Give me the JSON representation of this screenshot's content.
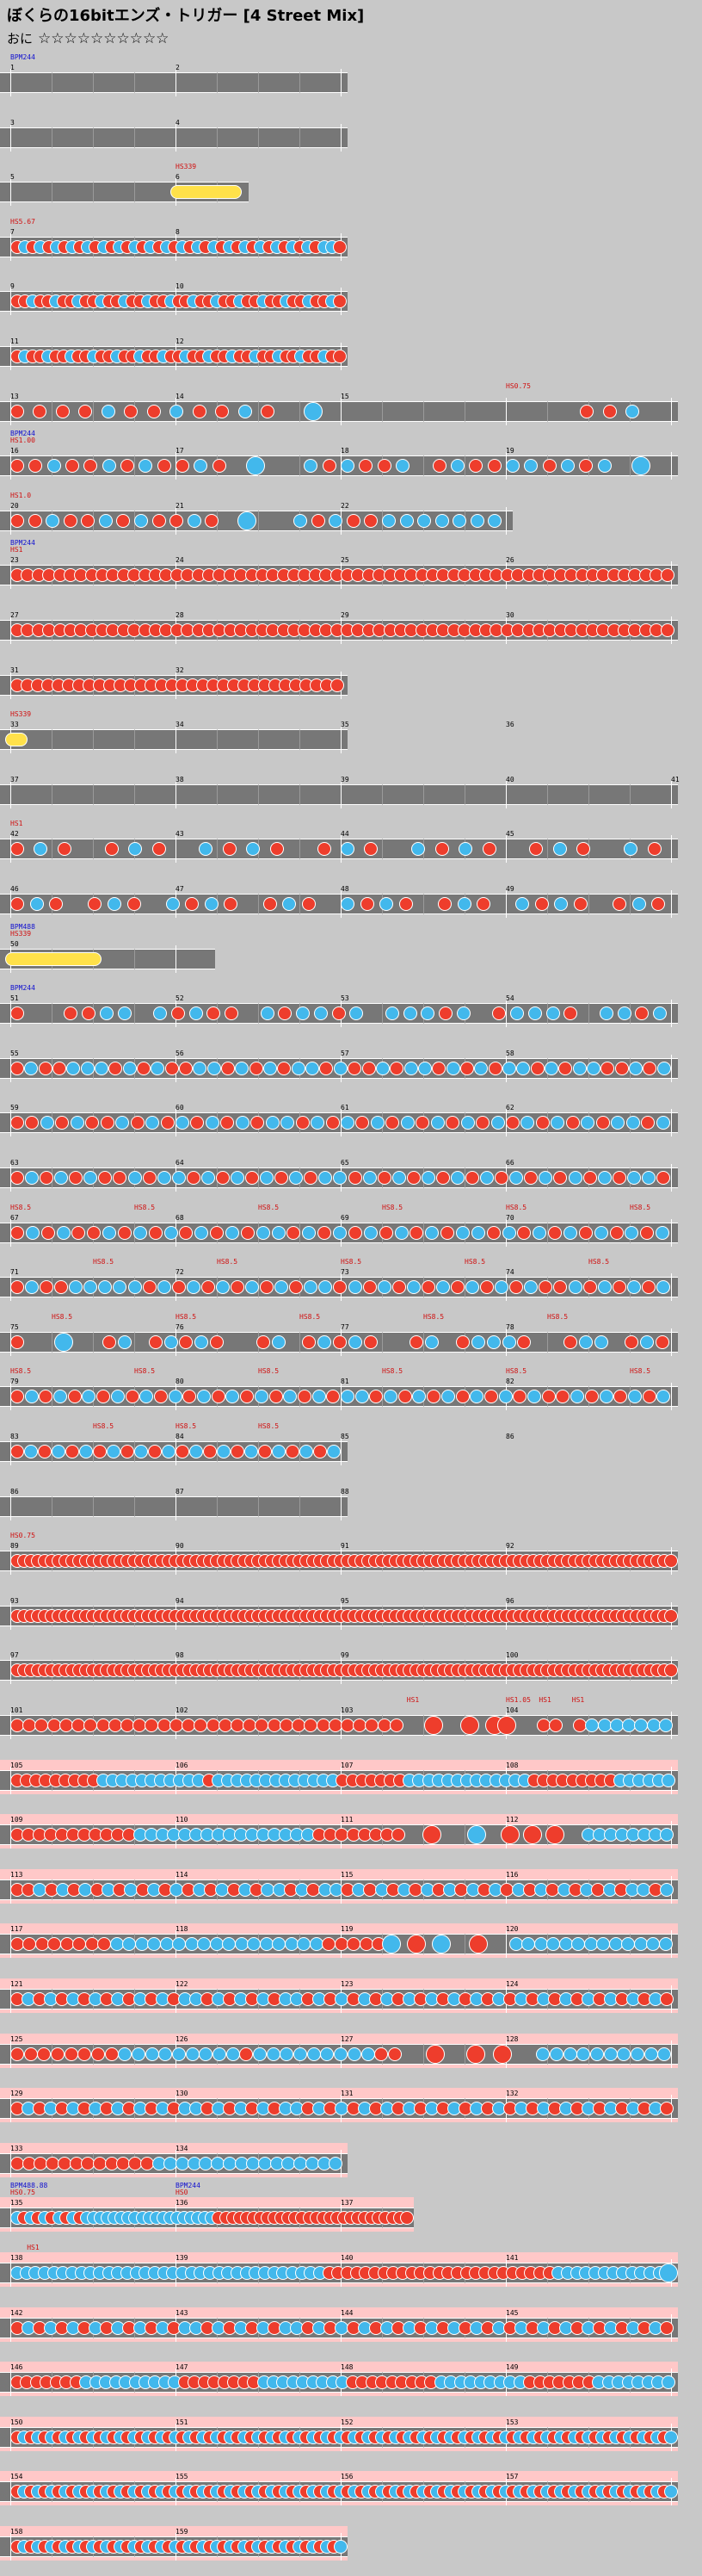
{
  "header": {
    "title": "ぼくらの16bitエンズ・トリガー [4 Street Mix]",
    "difficulty_label": "おに",
    "stars": "☆☆☆☆☆☆☆☆☆☆"
  },
  "colors": {
    "background": "#c8c8c8",
    "lane": "#777777",
    "don": "#ee3d2c",
    "ka": "#42b8ec",
    "roll": "#ffe14a",
    "gogo": "#ffc8c8",
    "bpm_text": "#1010d0",
    "hs_text": "#d01010"
  },
  "rows": [
    {
      "numbers": [
        "1",
        "2"
      ],
      "measures": 2,
      "events": [
        {
          "text": "BPM244",
          "type": "bpm",
          "measure": 0
        }
      ],
      "pattern": ""
    },
    {
      "numbers": [
        "3",
        "4"
      ],
      "measures": 2,
      "events": [],
      "pattern": ""
    },
    {
      "numbers": [
        "5",
        "6"
      ],
      "measures": 1.4,
      "events": [
        {
          "text": "HS339",
          "type": "hs",
          "measure": 1
        }
      ],
      "pattern": "roll:1.0-1.35"
    },
    {
      "numbers": [
        "7",
        "8"
      ],
      "measures": 2,
      "events": [
        {
          "text": "HS5.67",
          "type": "hs",
          "measure": 0
        }
      ],
      "pattern": "dkdkdkdkdkdkdkdkdkdkdkdkdkdkdkdkdkdkdkdkkd"
    },
    {
      "numbers": [
        "9",
        "10"
      ],
      "measures": 2,
      "events": [],
      "pattern": "ddkddkddkddkddkddkddkddkddkddkddkddkddkddkd"
    },
    {
      "numbers": [
        "11",
        "12"
      ],
      "measures": 2,
      "events": [],
      "pattern": "dkddkddkddkddkddkddkddkddkddkddkddkddkddkdd"
    },
    {
      "numbers": [
        "13",
        "14",
        "15"
      ],
      "measures": 4,
      "events": [
        {
          "text": "HS0.75",
          "type": "hs",
          "measure": 3
        }
      ],
      "pattern": "ddddkddkddkd.K...........ddk."
    },
    {
      "numbers": [
        "16",
        "17",
        "18",
        "19"
      ],
      "measures": 4,
      "events": [
        {
          "text": "HS1.00",
          "type": "hs",
          "measure": 0
        },
        {
          "text": "BPM244",
          "type": "bpm",
          "measure": 0
        }
      ],
      "pattern": "ddkddkdkddkd.K..kdkddk.dkddkkdkdk.K."
    },
    {
      "numbers": [
        "20",
        "21",
        "22"
      ],
      "measures": 3,
      "events": [
        {
          "text": "HS1.0",
          "type": "hs",
          "measure": 0
        }
      ],
      "pattern": "ddkddkdkddkd.K..kdkddkkkkkkk"
    },
    {
      "numbers": [
        "23",
        "24",
        "25",
        "26"
      ],
      "measures": 4,
      "events": [
        {
          "text": "HS1",
          "type": "hs",
          "measure": 0
        },
        {
          "text": "BPM244",
          "type": "bpm",
          "measure": 0
        }
      ],
      "pattern": "dddddddddddddddddddddddddddddddddddddddddddddddddddddddddddddd"
    },
    {
      "numbers": [
        "27",
        "28",
        "29",
        "30"
      ],
      "measures": 4,
      "events": [],
      "pattern": "dddddddddddddddddddddddddddddddddddddddddddddddddddddddddddddd"
    },
    {
      "numbers": [
        "31",
        "32"
      ],
      "measures": 2,
      "events": [],
      "pattern": "dddddddddddddddddddddddddddddddd"
    },
    {
      "numbers": [
        "33",
        "34",
        "35",
        "36"
      ],
      "measures": 2,
      "events": [
        {
          "text": "HS339",
          "type": "hs",
          "measure": 0
        }
      ],
      "pattern": "roll:0.0-0.05"
    },
    {
      "numbers": [
        "37",
        "38",
        "39",
        "40",
        "41"
      ],
      "measures": 4,
      "events": [],
      "pattern": ""
    },
    {
      "numbers": [
        "42",
        "43",
        "44",
        "45"
      ],
      "measures": 4,
      "events": [
        {
          "text": "HS1",
          "type": "hs",
          "measure": 0
        }
      ],
      "pattern": "dkd.dkd.kdkd.dkd.kdkd.dkd.kd"
    },
    {
      "numbers": [
        "46",
        "47",
        "48",
        "49"
      ],
      "measures": 4,
      "events": [],
      "pattern": "dkd.dkd.kdkd.dkd.kdkd.dkd.kdkd.dkd"
    },
    {
      "numbers": [
        "50"
      ],
      "measures": 1.2,
      "events": [
        {
          "text": "HS339",
          "type": "hs",
          "measure": 0
        },
        {
          "text": "BPM488",
          "type": "bpm",
          "measure": 0
        }
      ],
      "pattern": "roll:0.0-0.5"
    },
    {
      "numbers": [
        "51",
        "52",
        "53",
        "54"
      ],
      "measures": 4,
      "events": [
        {
          "text": "BPM244",
          "type": "bpm",
          "measure": 0
        }
      ],
      "pattern": "d..ddkk.kdkdd.kdkkdk.kkkdk.dkkkd.kkdk"
    },
    {
      "numbers": [
        "55",
        "56",
        "57",
        "58"
      ],
      "measures": 4,
      "events": [],
      "pattern": "dkddkkkdkdkddkkdkdkdkkdkddkdkkdkdkdkkdkdkkddkdk"
    },
    {
      "numbers": [
        "59",
        "60",
        "61",
        "62"
      ],
      "measures": 4,
      "events": [],
      "pattern": "ddkdkddkdkdkdkdkdkkdkdkdkdkdkdkdkdkdkdkdkkdk"
    },
    {
      "numbers": [
        "63",
        "64",
        "65",
        "66"
      ],
      "measures": 4,
      "events": [],
      "pattern": "dkdkdkddkdkkdkdkdkdkdkkdkdkdkdkdkdkdkdkdkdkkd"
    },
    {
      "numbers": [
        "67",
        "68",
        "69",
        "70"
      ],
      "measures": 4,
      "events": [
        {
          "text": "HS8.5",
          "type": "hs",
          "measure": 0
        },
        {
          "text": "HS8.5",
          "type": "hs",
          "measure": 0.75
        },
        {
          "text": "HS8.5",
          "type": "hs",
          "measure": 1.5
        },
        {
          "text": "HS8.5",
          "type": "hs",
          "measure": 2.25
        },
        {
          "text": "HS8.5",
          "type": "hs",
          "measure": 3.0
        },
        {
          "text": "HS8.5",
          "type": "hs",
          "measure": 3.75
        }
      ],
      "pattern": "dkdkddkdkdkdkdkdkkdkdkdkdkdkdkkdkdkdkdkdkdk"
    },
    {
      "numbers": [
        "71",
        "72",
        "73",
        "74"
      ],
      "measures": 4,
      "events": [
        {
          "text": "HS8.5",
          "type": "hs",
          "measure": 0.5
        },
        {
          "text": "HS8.5",
          "type": "hs",
          "measure": 1.25
        },
        {
          "text": "HS8.5",
          "type": "hs",
          "measure": 2.0
        },
        {
          "text": "HS8.5",
          "type": "hs",
          "measure": 2.75
        },
        {
          "text": "HS8.5",
          "type": "hs",
          "measure": 3.5
        }
      ],
      "pattern": "dkddkkkkkdkdkdkdkdkdkkdkdkdkdkdkdkdkddkdkdkdk"
    },
    {
      "numbers": [
        "75",
        "76",
        "77",
        "78"
      ],
      "measures": 4,
      "events": [
        {
          "text": "HS8.5",
          "type": "hs",
          "measure": 0.25
        },
        {
          "text": "HS8.5",
          "type": "hs",
          "measure": 1.0
        },
        {
          "text": "HS8.5",
          "type": "hs",
          "measure": 1.75
        },
        {
          "text": "HS8.5",
          "type": "hs",
          "measure": 2.5
        },
        {
          "text": "HS8.5",
          "type": "hs",
          "measure": 3.25
        }
      ],
      "pattern": "d..K..dk.dkdkd..dk.dkdkd..dk.dkkkd..dkk.dkd"
    },
    {
      "numbers": [
        "79",
        "80",
        "81",
        "82"
      ],
      "measures": 4,
      "events": [
        {
          "text": "HS8.5",
          "type": "hs",
          "measure": 0
        },
        {
          "text": "HS8.5",
          "type": "hs",
          "measure": 0.75
        },
        {
          "text": "HS8.5",
          "type": "hs",
          "measure": 1.5
        },
        {
          "text": "HS8.5",
          "type": "hs",
          "measure": 2.25
        },
        {
          "text": "HS8.5",
          "type": "hs",
          "measure": 3.0
        },
        {
          "text": "HS8.5",
          "type": "hs",
          "measure": 3.75
        }
      ],
      "pattern": "dkdkdkdkdkdkdkdkdkdkdkdkkdkdkdkdkdkdkddkdkdkdk"
    },
    {
      "numbers": [
        "83",
        "84",
        "85",
        "86"
      ],
      "measures": 2,
      "events": [
        {
          "text": "HS8.5",
          "type": "hs",
          "measure": 0.5
        },
        {
          "text": "HS8.5",
          "type": "hs",
          "measure": 1.0
        },
        {
          "text": "HS8.5",
          "type": "hs",
          "measure": 1.5
        }
      ],
      "pattern": "dkdkdkdkdkdkdkdkdkdkdkdk"
    },
    {
      "numbers": [
        "86",
        "87",
        "88"
      ],
      "measures": 2,
      "events": [],
      "pattern": ""
    },
    {
      "numbers": [
        "89",
        "90",
        "91",
        "92"
      ],
      "measures": 4,
      "events": [
        {
          "text": "HS0.75",
          "type": "hs",
          "measure": 0
        }
      ],
      "pattern": "X96"
    },
    {
      "numbers": [
        "93",
        "94",
        "95",
        "96"
      ],
      "measures": 4,
      "events": [],
      "pattern": "X96"
    },
    {
      "numbers": [
        "97",
        "98",
        "99",
        "100"
      ],
      "measures": 4,
      "events": [],
      "pattern": "X96"
    },
    {
      "numbers": [
        "101",
        "102",
        "103",
        "104"
      ],
      "measures": 4,
      "events": [
        {
          "text": "HS1",
          "type": "hs",
          "measure": 2.4
        },
        {
          "text": "HS1.05",
          "type": "hs",
          "measure": 3.0
        },
        {
          "text": "HS1",
          "type": "hs",
          "measure": 3.2
        },
        {
          "text": "HS1",
          "type": "hs",
          "measure": 3.4
        }
      ],
      "pattern": "dddddddddddddddddddddddddddddddd..D..D.DD..dd.dkkkkkkk"
    },
    {
      "numbers": [
        "105",
        "106",
        "107",
        "108"
      ],
      "measures": 4,
      "events": [],
      "pattern": "gogo:dddddddddkkkkkkkkkkkdkkkkkkkkkkkkkdddddddkkkkkkkkkkkkkdddddddddkkkkkk"
    },
    {
      "numbers": [
        "109",
        "110",
        "111",
        "112"
      ],
      "measures": 4,
      "events": [],
      "pattern": "gogo:dddddddddddkkkkkkkkkkkkkkkkdddddddd..D...K..D.D.D..kkkkkkkk"
    },
    {
      "numbers": [
        "113",
        "114",
        "115",
        "116"
      ],
      "measures": 4,
      "events": [],
      "pattern": "gogo:ddkdkdkdkdkdkdkdkdkdkdkkdkdkkdkdkdkdkdkdkdkdkdkdkdkdkdkkdk"
    },
    {
      "numbers": [
        "117",
        "118",
        "119",
        "120"
      ],
      "measures": 4,
      "events": [],
      "pattern": "gogo:ddddddddkkkkkkkkkkkkkkkkkdddddK.D.K..D..kkkkkkkkkkkkk"
    },
    {
      "numbers": [
        "121",
        "122",
        "123",
        "124"
      ],
      "measures": 4,
      "events": [],
      "pattern": "gogo:dkdkdkdkdkdkdkdkkdkdkdkdkkdkdkdkdkdkdkdkdkdkdkdkdkdkdkdkdkd"
    },
    {
      "numbers": [
        "125",
        "126",
        "127",
        "128"
      ],
      "measures": 4,
      "events": [],
      "pattern": "gogo:ddddddddkkkkkkkkkdkkkkkkkkkdd..D..D.D..kkkkkkkkkk"
    },
    {
      "numbers": [
        "129",
        "130",
        "131",
        "132"
      ],
      "measures": 4,
      "events": [],
      "pattern": "gogo:dkdkdkdkdkdkdkdkkdkdkdkdkkdkdkdkdkdkdkdkdkdkdkdkdkdkdkdkdkd"
    },
    {
      "numbers": [
        "133",
        "134"
      ],
      "measures": 2,
      "events": [],
      "pattern": "gogo:ddddddddddddkkkkkkkkkkkkkkkk"
    },
    {
      "numbers": [
        "135",
        "136",
        "137"
      ],
      "measures": 2.4,
      "events": [
        {
          "text": "HS0.75",
          "type": "hs",
          "measure": 0
        },
        {
          "text": "BPM488.88",
          "type": "bpm",
          "measure": 0
        },
        {
          "text": "HS0",
          "type": "hs",
          "measure": 1.0
        },
        {
          "text": "BPM244",
          "type": "bpm",
          "measure": 1.0
        }
      ],
      "pattern": "gogo:kdkdkdkdkdkkkkkkkkkkkkkkkkkkkdddddddddddddddddddddddddddd"
    },
    {
      "numbers": [
        "138",
        "139",
        "140",
        "141"
      ],
      "measures": 4,
      "events": [
        {
          "text": "HS1",
          "type": "hs",
          "measure": 0.1
        }
      ],
      "pattern": "gogo:kkkkkkkkkkkkkkkkkkkkkkkkkkkkkkkkkkdddddddddddddddddddddddddkkkkkkkkkkkkK"
    },
    {
      "numbers": [
        "142",
        "143",
        "144",
        "145"
      ],
      "measures": 4,
      "events": [],
      "pattern": "gogo:dkdkdkdkdkdkdkdkkdkdkdkdkkdkdkdkdkdkdkdkdkdkdkdkdkdkdkdkdkd"
    },
    {
      "numbers": [
        "146",
        "147",
        "148",
        "149"
      ],
      "measures": 4,
      "events": [],
      "pattern": "gogo:dddddddkkkkkkkkkkddddddddkkkkkkkkkdddddddddkkkkkkkkkdddddddkkkkkkkk"
    },
    {
      "numbers": [
        "150",
        "151",
        "152",
        "153"
      ],
      "measures": 4,
      "events": [],
      "pattern": "gogo:X96k"
    },
    {
      "numbers": [
        "154",
        "155",
        "156",
        "157"
      ],
      "measures": 4,
      "events": [],
      "pattern": "gogo:X96k"
    },
    {
      "numbers": [
        "158",
        "159"
      ],
      "measures": 2,
      "events": [],
      "pattern": "gogo:X48k"
    }
  ]
}
